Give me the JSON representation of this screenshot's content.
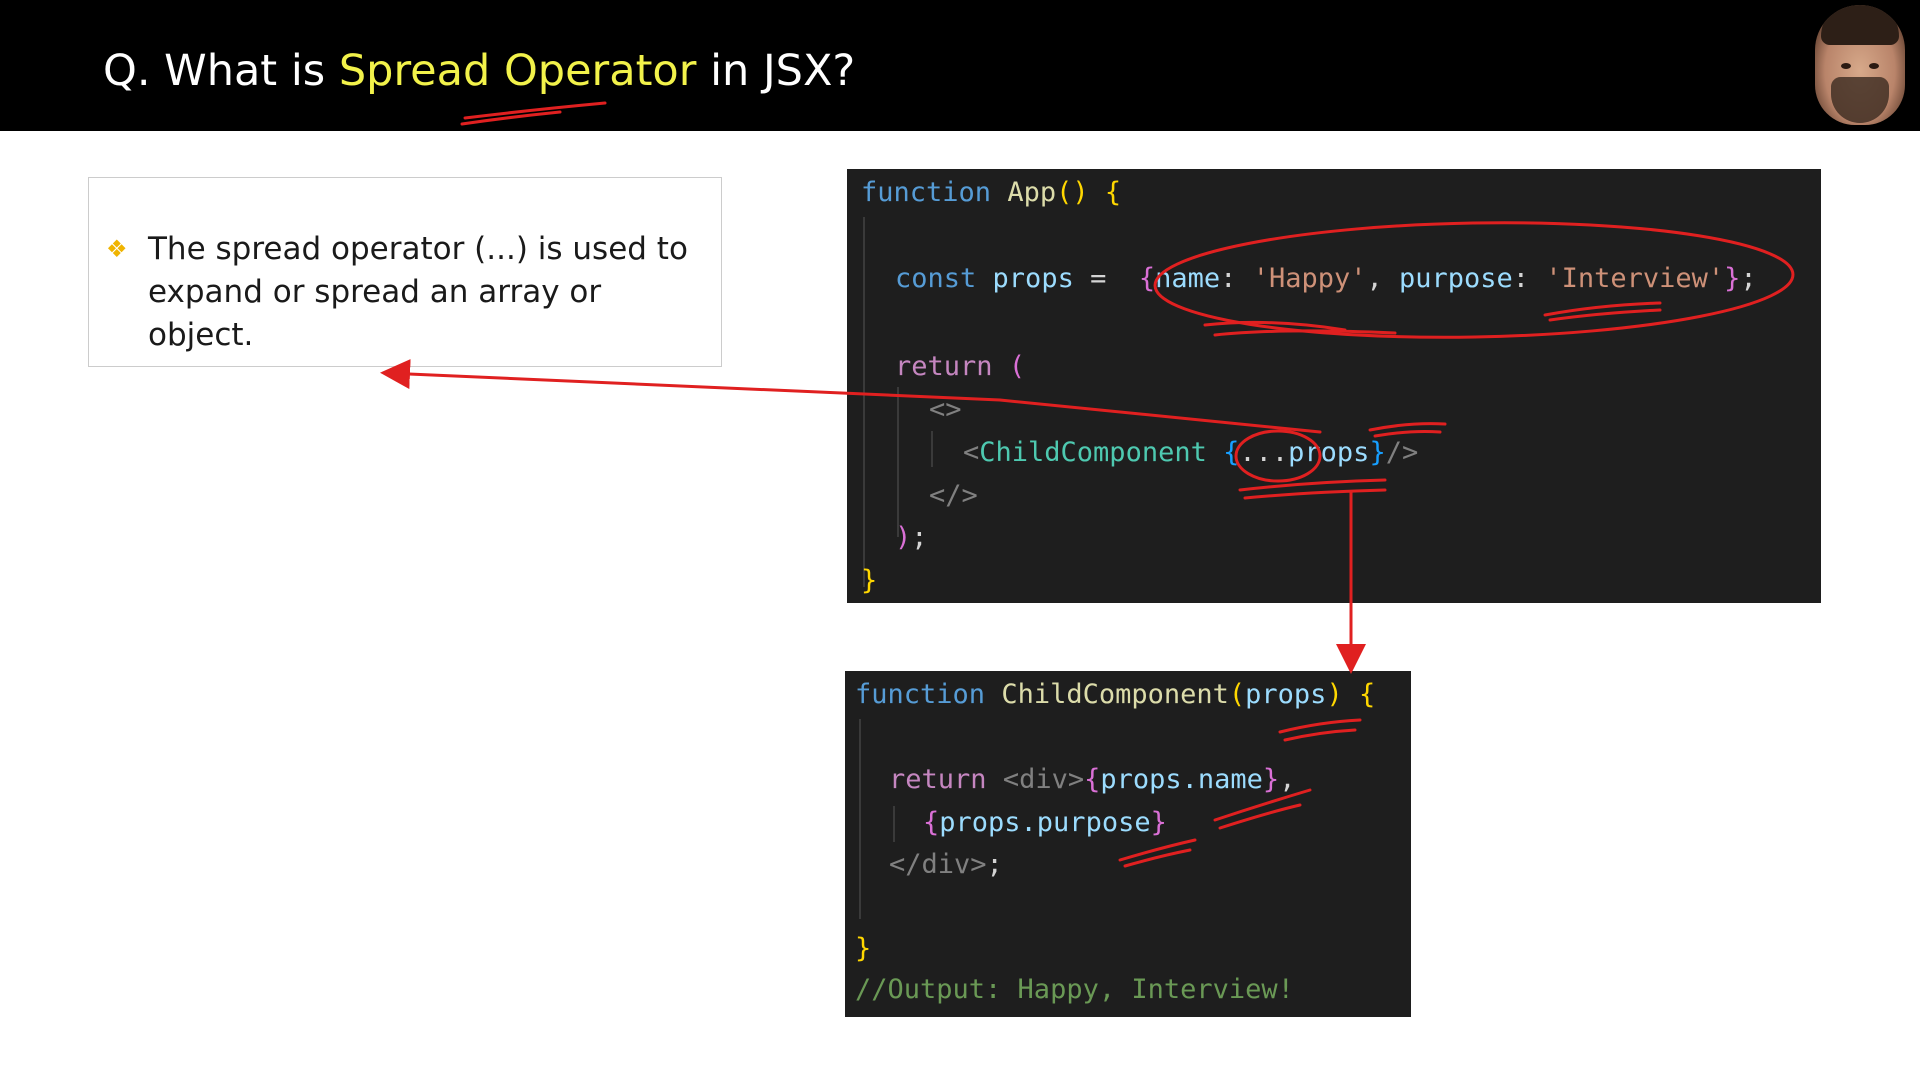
{
  "header": {
    "title_prefix": "Q. What is ",
    "title_highlight": "Spread Operator",
    "title_suffix": " in JSX?"
  },
  "note": {
    "bullet": "❖",
    "text": "The spread operator (...) is used to expand or spread an array or object."
  },
  "app_code": {
    "l1_kw": "function",
    "l1_name": "App",
    "l1_parens": "()",
    "l1_brace": "{",
    "l2_kw": "const",
    "l2_var": "props",
    "l2_eq": " = ",
    "l2_open": "{",
    "l2_key1": "name",
    "l2_colon1": ": ",
    "l2_val1": "'Happy'",
    "l2_comma": ", ",
    "l2_key2": "purpose",
    "l2_colon2": ": ",
    "l2_val2": "'Interview'",
    "l2_close": "}",
    "l2_semi": ";",
    "l3_kw": "return",
    "l3_paren": "(",
    "l4_frag": "<>",
    "l5_lt": "<",
    "l5_comp": "ChildComponent",
    "l5_open": "{",
    "l5_spread": "...",
    "l5_props": "props",
    "l5_close": "}",
    "l5_end": "/>",
    "l6_frag": "</>",
    "l7_paren": ")",
    "l7_semi": ";",
    "l8_brace": "}"
  },
  "child_code": {
    "l1_kw": "function",
    "l1_name": "ChildComponent",
    "l1_open": "(",
    "l1_param": "props",
    "l1_close": ")",
    "l1_brace": "{",
    "l2_kw": "return",
    "l2_tag": "<div>",
    "l2_open": "{",
    "l2_expr": "props.name",
    "l2_close": "}",
    "l2_comma": ",",
    "l3_open": "{",
    "l3_expr": "props.purpose",
    "l3_close": "}",
    "l4_tag": "</div>",
    "l4_semi": ";",
    "l5_brace": "}",
    "l6_comment": "//Output: Happy, Interview!"
  },
  "colors": {
    "header_bg": "#000000",
    "highlight": "#f2f24a",
    "code_bg": "#1e1e1e",
    "annotation": "#e02020"
  }
}
